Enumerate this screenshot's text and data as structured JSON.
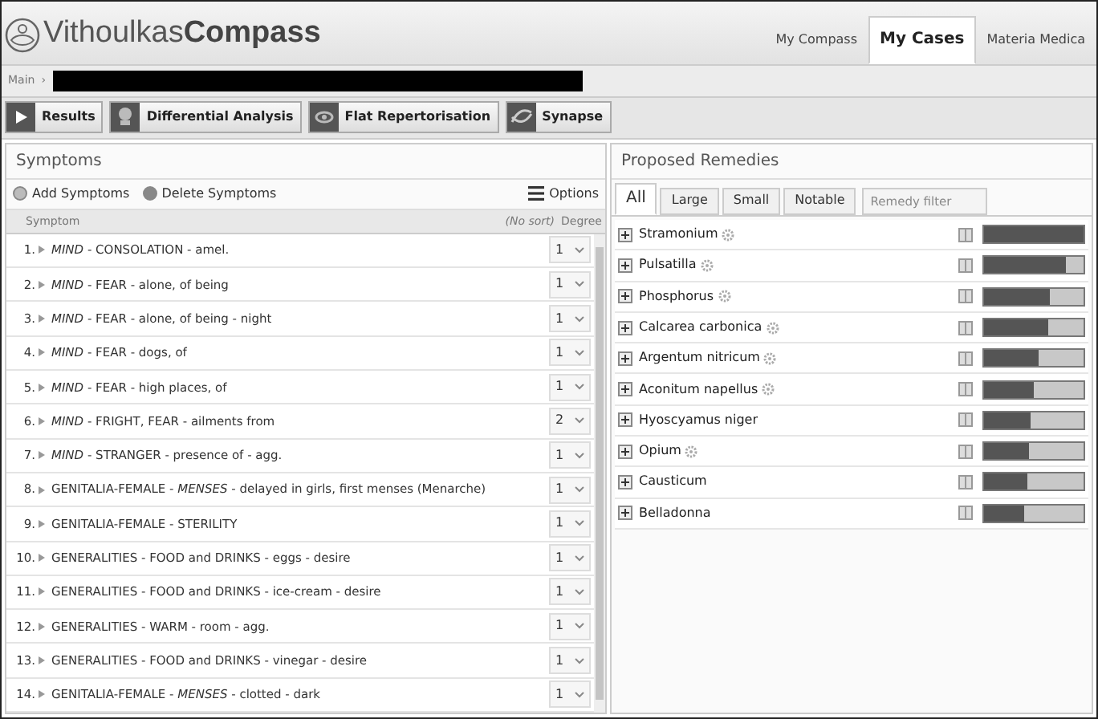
{
  "header": {
    "logo_light": "Vithoulkas",
    "logo_bold": "Compass",
    "nav": [
      {
        "label": "My Compass",
        "selected": false
      },
      {
        "label": "My Cases",
        "selected": true
      },
      {
        "label": "Materia Medica",
        "selected": false
      }
    ]
  },
  "breadcrumb": {
    "root": "Main",
    "separator": "›"
  },
  "toolbar": [
    {
      "label": "Results"
    },
    {
      "label": "Differential Analysis"
    },
    {
      "label": "Flat Repertorisation"
    },
    {
      "label": "Synapse"
    }
  ],
  "symptoms": {
    "title": "Symptoms",
    "actions": [
      "Add Symptoms",
      "Delete Symptoms"
    ],
    "options": "Options",
    "columns": {
      "symptom": "Symptom",
      "sort": "(No sort)",
      "degree": "Degree"
    },
    "rows": [
      {
        "number": "1.",
        "text": "*MIND* - CONSOLATION - amel.",
        "degree": "1"
      },
      {
        "number": "2.",
        "text": "*MIND* - FEAR - alone, of being",
        "degree": "1"
      },
      {
        "number": "3.",
        "text": "*MIND* - FEAR - alone, of being - night",
        "degree": "1"
      },
      {
        "number": "4.",
        "text": "*MIND* - FEAR - dogs, of",
        "degree": "1"
      },
      {
        "number": "5.",
        "text": "*MIND* - FEAR - high places, of",
        "degree": "1"
      },
      {
        "number": "6.",
        "text": "*MIND* - FRIGHT, FEAR - ailments from",
        "degree": "2"
      },
      {
        "number": "7.",
        "text": "*MIND* - STRANGER - presence of - agg.",
        "degree": "1"
      },
      {
        "number": "8.",
        "text": "GENITALIA-FEMALE - *MENSES* - delayed in girls, first menses (Menarche)",
        "degree": "1"
      },
      {
        "number": "9.",
        "text": "GENITALIA-FEMALE - STERILITY",
        "degree": "1"
      },
      {
        "number": "10.",
        "text": "GENERALITIES - FOOD and DRINKS - eggs - desire",
        "degree": "1"
      },
      {
        "number": "11.",
        "text": "GENERALITIES - FOOD and DRINKS - ice-cream - desire",
        "degree": "1"
      },
      {
        "number": "12.",
        "text": "GENERALITIES - WARM - room - agg.",
        "degree": "1"
      },
      {
        "number": "13.",
        "text": "GENERALITIES - FOOD and DRINKS - vinegar - desire",
        "degree": "1"
      },
      {
        "number": "14.",
        "text": "GENITALIA-FEMALE - *MENSES* - clotted - dark",
        "degree": "1"
      }
    ]
  },
  "remedies": {
    "title": "Proposed Remedies",
    "tabs": [
      {
        "label": "All",
        "selected": true
      },
      {
        "label": "Large",
        "selected": false
      },
      {
        "label": "Small",
        "selected": false
      },
      {
        "label": "Notable",
        "selected": false
      }
    ],
    "filter": {
      "placeholder": "Remedy filter"
    },
    "items": [
      {
        "name": "Stramonium",
        "gear": true,
        "level": 1.0
      },
      {
        "name": "Pulsatilla",
        "gear": true,
        "level": 0.82
      },
      {
        "name": "Phosphorus",
        "gear": true,
        "level": 0.66
      },
      {
        "name": "Calcarea carbonica",
        "gear": true,
        "level": 0.65
      },
      {
        "name": "Argentum nitricum",
        "gear": true,
        "level": 0.55
      },
      {
        "name": "Aconitum napellus",
        "gear": true,
        "level": 0.5
      },
      {
        "name": "Hyoscyamus niger",
        "gear": false,
        "level": 0.47
      },
      {
        "name": "Opium",
        "gear": true,
        "level": 0.45
      },
      {
        "name": "Causticum",
        "gear": false,
        "level": 0.43
      },
      {
        "name": "Belladonna",
        "gear": false,
        "level": 0.41
      }
    ]
  }
}
